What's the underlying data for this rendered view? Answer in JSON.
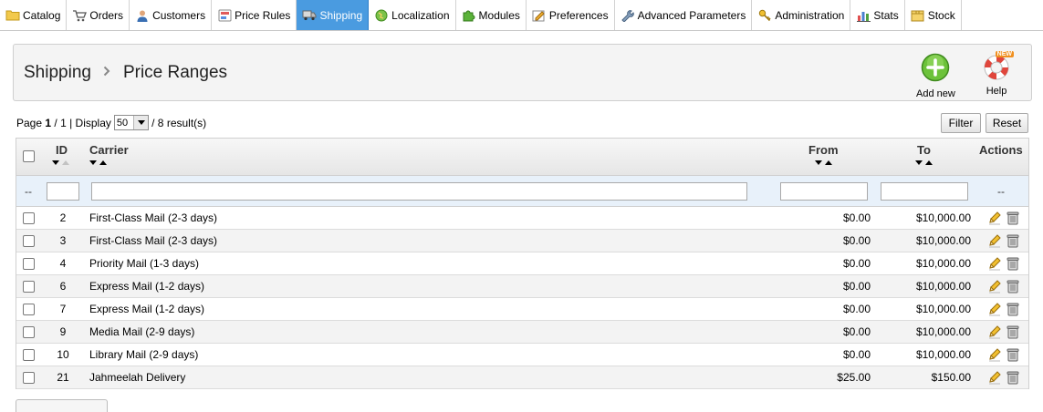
{
  "tabs": [
    {
      "label": "Catalog",
      "icon": "folder-icon"
    },
    {
      "label": "Orders",
      "icon": "cart-icon"
    },
    {
      "label": "Customers",
      "icon": "user-icon"
    },
    {
      "label": "Price Rules",
      "icon": "price-tag-icon"
    },
    {
      "label": "Shipping",
      "icon": "truck-icon",
      "active": true
    },
    {
      "label": "Localization",
      "icon": "globe-icon"
    },
    {
      "label": "Modules",
      "icon": "puzzle-icon"
    },
    {
      "label": "Preferences",
      "icon": "preferences-icon"
    },
    {
      "label": "Advanced Parameters",
      "icon": "wrench-icon"
    },
    {
      "label": "Administration",
      "icon": "key-icon"
    },
    {
      "label": "Stats",
      "icon": "bar-chart-icon"
    },
    {
      "label": "Stock",
      "icon": "box-icon"
    }
  ],
  "breadcrumb": {
    "parent": "Shipping",
    "current": "Price Ranges"
  },
  "toolbar": {
    "add_new": "Add new",
    "help": "Help",
    "help_badge": "NEW"
  },
  "pagination": {
    "page_word": "Page",
    "current_page": "1",
    "separator": "/ 1 | Display",
    "per_page": "50",
    "results": "/ 8 result(s)"
  },
  "buttons": {
    "filter": "Filter",
    "reset": "Reset"
  },
  "table": {
    "headers": {
      "id": "ID",
      "carrier": "Carrier",
      "from": "From",
      "to": "To",
      "actions": "Actions"
    },
    "filter_placeholder_left": "--",
    "filter_placeholder_right": "--",
    "rows": [
      {
        "id": "2",
        "carrier": "First-Class Mail (2-3 days)",
        "from": "$0.00",
        "to": "$10,000.00"
      },
      {
        "id": "3",
        "carrier": "First-Class Mail (2-3 days)",
        "from": "$0.00",
        "to": "$10,000.00"
      },
      {
        "id": "4",
        "carrier": "Priority Mail (1-3 days)",
        "from": "$0.00",
        "to": "$10,000.00"
      },
      {
        "id": "6",
        "carrier": "Express Mail (1-2 days)",
        "from": "$0.00",
        "to": "$10,000.00"
      },
      {
        "id": "7",
        "carrier": "Express Mail (1-2 days)",
        "from": "$0.00",
        "to": "$10,000.00"
      },
      {
        "id": "9",
        "carrier": "Media Mail (2-9 days)",
        "from": "$0.00",
        "to": "$10,000.00"
      },
      {
        "id": "10",
        "carrier": "Library Mail (2-9 days)",
        "from": "$0.00",
        "to": "$10,000.00"
      },
      {
        "id": "21",
        "carrier": "Jahmeelah Delivery",
        "from": "$25.00",
        "to": "$150.00"
      }
    ]
  },
  "colors": {
    "active_tab": "#4a9be0",
    "filter_row": "#e8f1fa",
    "add_button": "#6cc23a",
    "help_ring": "#e0463c"
  }
}
